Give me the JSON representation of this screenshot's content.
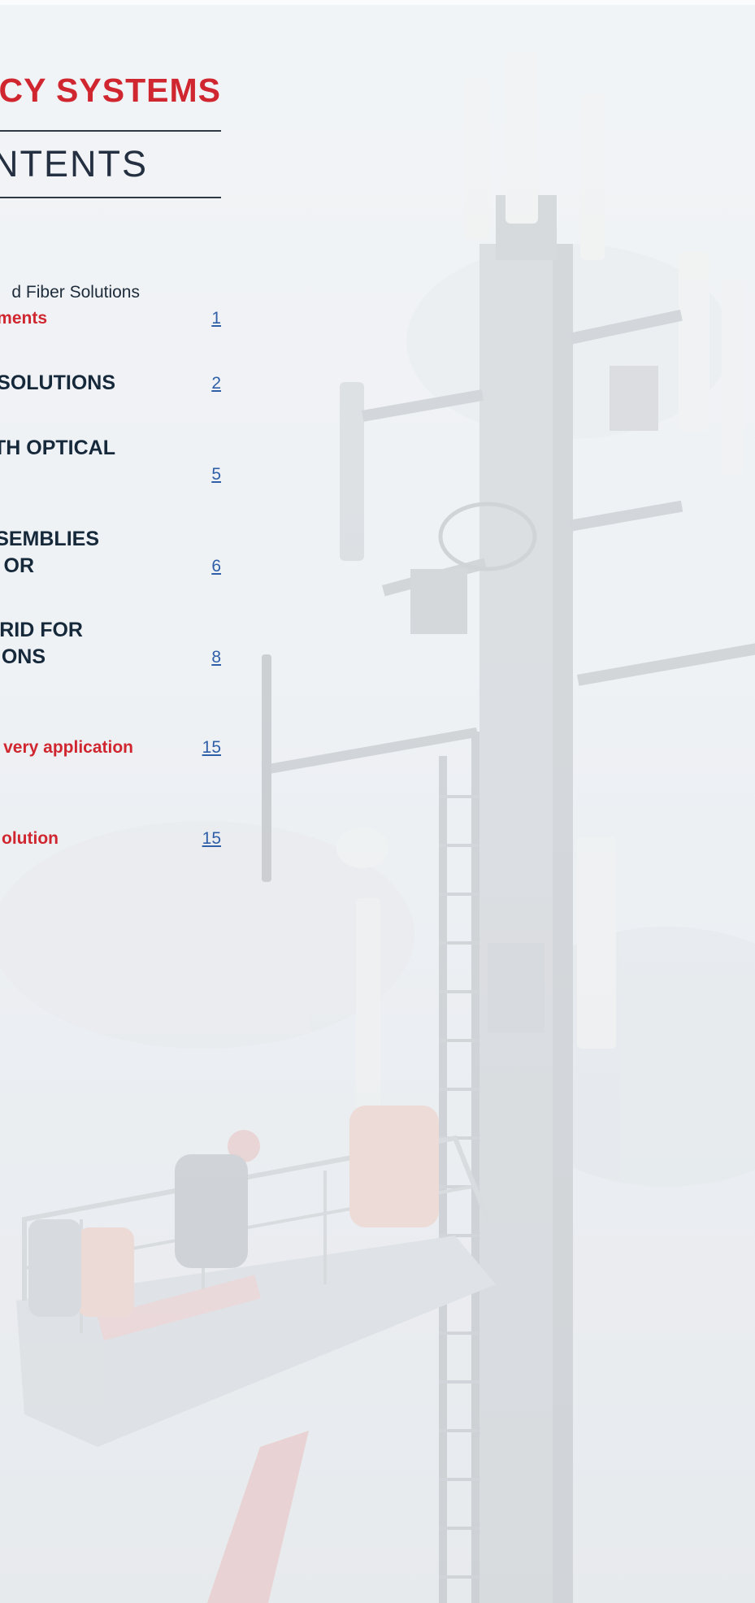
{
  "document": {
    "title": "ICY SYSTEMS",
    "contents_heading": "ONTENTS"
  },
  "toc": [
    {
      "lines": [
        "d Fiber Solutions"
      ],
      "style": "sub",
      "page": ""
    },
    {
      "lines": [
        "ments"
      ],
      "style": "red",
      "page": "1"
    },
    {
      "lines": [
        "SOLUTIONS"
      ],
      "style": "dark",
      "page": "2"
    },
    {
      "lines": [
        "TH OPTICAL"
      ],
      "style": "dark",
      "page": "5"
    },
    {
      "lines": [
        "SEMBLIES",
        "OR"
      ],
      "style": "dark",
      "page": "6"
    },
    {
      "lines": [
        "RID FOR",
        "ONS"
      ],
      "style": "dark",
      "page": "8"
    },
    {
      "lines": [
        "very application"
      ],
      "style": "red",
      "page": "15"
    },
    {
      "lines": [
        "olution"
      ],
      "style": "red",
      "page": "15"
    }
  ],
  "colors": {
    "accent_red": "#d0262f",
    "navy": "#16293b",
    "link_blue": "#2f5fa8"
  }
}
